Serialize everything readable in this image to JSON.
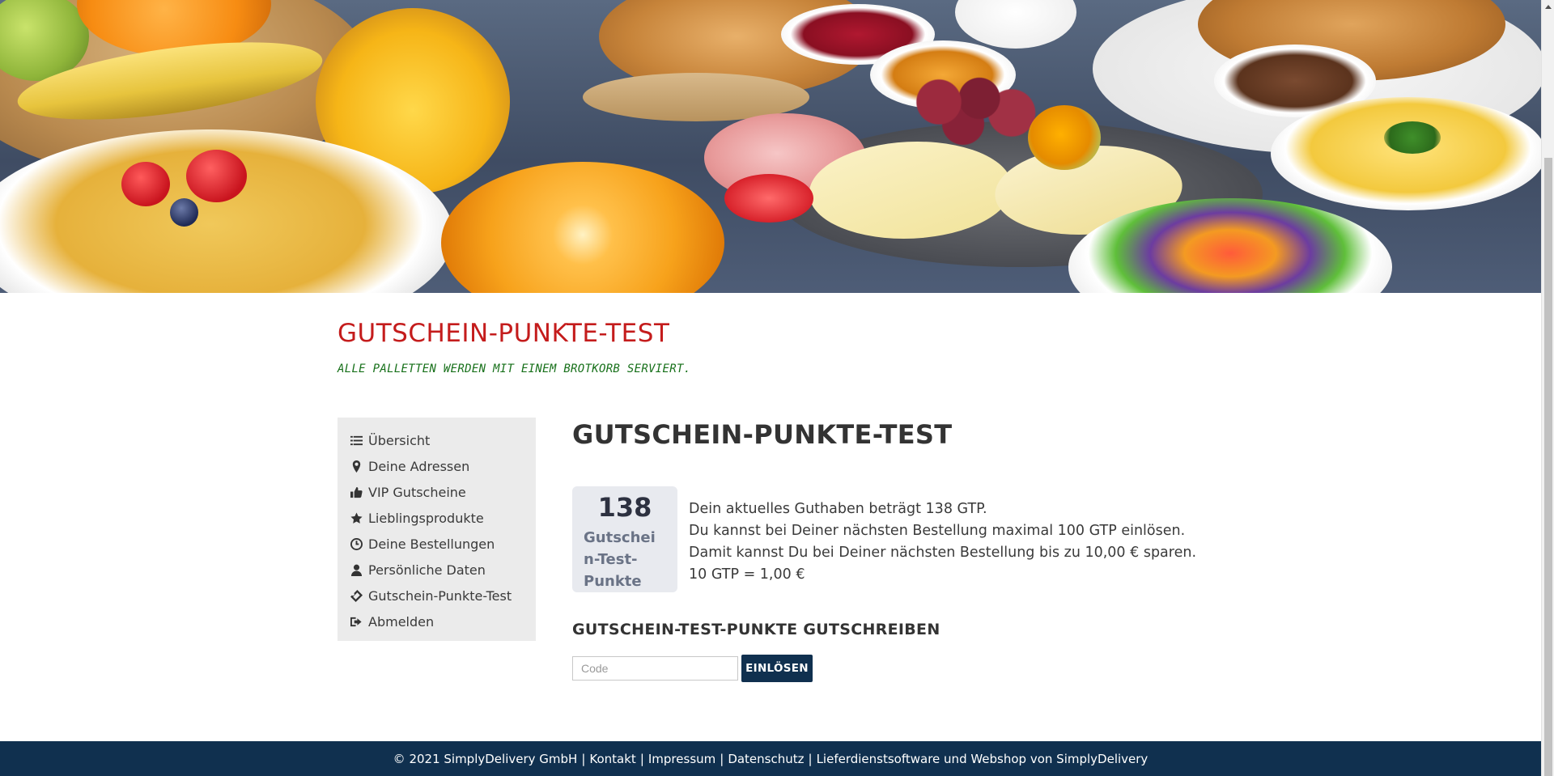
{
  "site": {
    "title": "GUTSCHEIN-PUNKTE-TEST",
    "slogan": "ALLE PALLETTEN WERDEN MIT EINEM BROTKORB SERVIERT."
  },
  "sidebar": {
    "items": [
      {
        "label": "Übersicht",
        "icon": "list-icon"
      },
      {
        "label": "Deine Adressen",
        "icon": "map-marker-icon"
      },
      {
        "label": "VIP Gutscheine",
        "icon": "thumbs-up-icon"
      },
      {
        "label": "Lieblingsprodukte",
        "icon": "star-icon"
      },
      {
        "label": "Deine Bestellungen",
        "icon": "clock-icon"
      },
      {
        "label": "Persönliche Daten",
        "icon": "user-icon"
      },
      {
        "label": "Gutschein-Punkte-Test",
        "icon": "ticket-icon"
      },
      {
        "label": "Abmelden",
        "icon": "sign-out-icon"
      }
    ]
  },
  "main": {
    "heading": "GUTSCHEIN-PUNKTE-TEST",
    "points_value": "138",
    "points_unit": "Gutschein-Test-Punkte",
    "info_lines": [
      "Dein aktuelles Guthaben beträgt 138 GTP.",
      "Du kannst bei Deiner nächsten Bestellung maximal 100 GTP einlösen.",
      "Damit kannst Du bei Deiner nächsten Bestellung bis zu 10,00 € sparen.",
      "10 GTP = 1,00 €"
    ],
    "redeem_heading": "GUTSCHEIN-TEST-PUNKTE GUTSCHREIBEN",
    "code_placeholder": "Code",
    "code_value": "",
    "redeem_button": "EINLÖSEN"
  },
  "footer": {
    "copyright": "© 2021 SimplyDelivery GmbH",
    "links": [
      "Kontakt",
      "Impressum",
      "Datenschutz",
      "Lieferdienstsoftware und Webshop von SimplyDelivery"
    ]
  },
  "colors": {
    "title_red": "#c41c1c",
    "slogan_green": "#17701a",
    "navy": "#10304f",
    "sidebar_bg": "#ebebeb",
    "points_bg": "#e8eaef"
  }
}
